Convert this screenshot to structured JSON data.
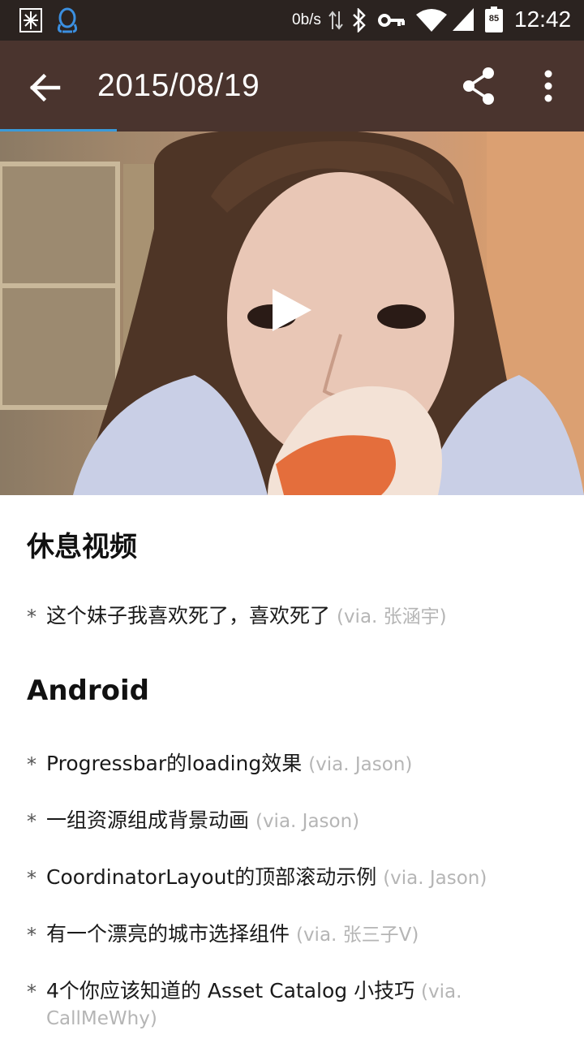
{
  "status_bar": {
    "net_speed": "0b/s",
    "battery_level": "85",
    "time": "12:42",
    "icons": [
      "app-logo-icon",
      "qq-penguin-icon",
      "data-arrows-icon",
      "bluetooth-icon",
      "vpn-key-icon",
      "wifi-icon",
      "cell-signal-icon",
      "battery-icon"
    ]
  },
  "toolbar": {
    "title": "2015/08/19",
    "icons": [
      "back-arrow-icon",
      "share-icon",
      "more-vert-icon"
    ]
  },
  "video": {
    "icon": "play-icon",
    "loading_progress": 0.2
  },
  "sections": [
    {
      "heading": "休息视频",
      "items": [
        {
          "text": "这个妹子我喜欢死了，喜欢死了",
          "via": "(via. 张涵宇)"
        }
      ]
    },
    {
      "heading": "Android",
      "items": [
        {
          "text": "Progressbar的loading效果",
          "via": "(via. Jason)"
        },
        {
          "text": "一组资源组成背景动画",
          "via": "(via. Jason)"
        },
        {
          "text": "CoordinatorLayout的顶部滚动示例",
          "via": "(via. Jason)"
        },
        {
          "text": "有一个漂亮的城市选择组件",
          "via": "(via. 张三子V)"
        },
        {
          "text": "4个你应该知道的 Asset Catalog 小技巧",
          "via": "(via. CallMeWhy)"
        }
      ]
    }
  ],
  "bullet": "*"
}
